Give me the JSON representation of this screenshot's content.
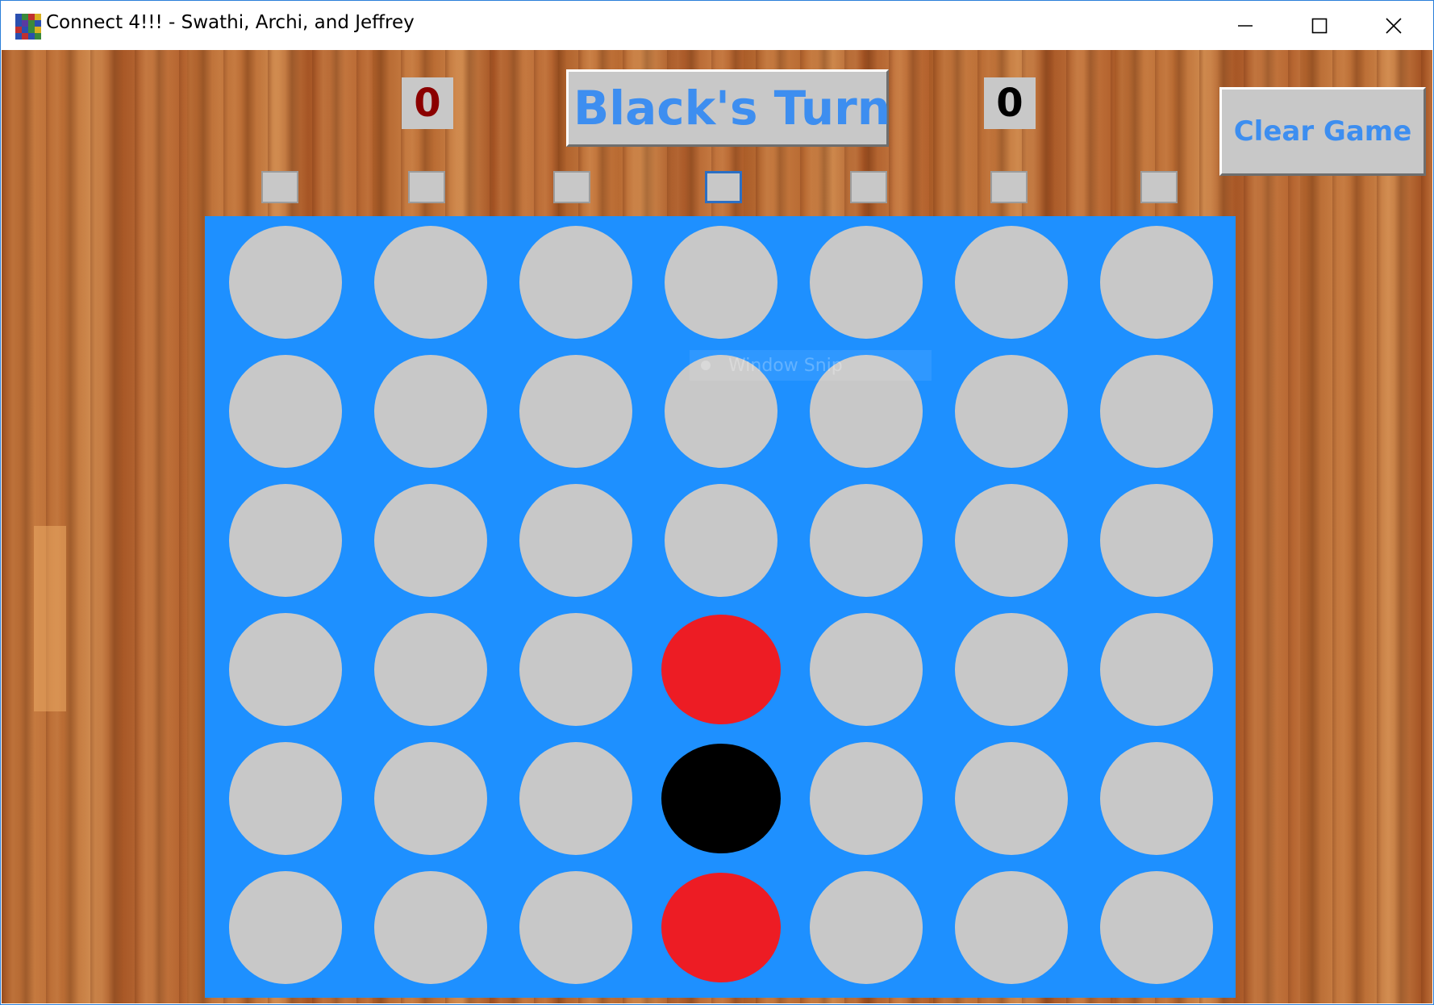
{
  "window": {
    "title": "Connect 4!!! - Swathi, Archi, and Jeffrey",
    "controls": [
      "minimize-icon",
      "maximize-icon",
      "close-icon"
    ]
  },
  "scores": {
    "red": "0",
    "black": "0",
    "red_color": "#8b0000",
    "black_color": "#000000"
  },
  "turn": {
    "text": "Black's Turn",
    "color": "#3d8ef0"
  },
  "clear_button": {
    "label": "Clear Game",
    "color": "#3d8ef0"
  },
  "colors": {
    "board": "#1e90ff",
    "empty": "#c8c8c8",
    "red": "#ed1c24",
    "black": "#000000"
  },
  "columns": 7,
  "rows": 6,
  "focused_column": 3,
  "board": [
    [
      "empty",
      "empty",
      "empty",
      "empty",
      "empty",
      "empty",
      "empty"
    ],
    [
      "empty",
      "empty",
      "empty",
      "empty",
      "empty",
      "empty",
      "empty"
    ],
    [
      "empty",
      "empty",
      "empty",
      "empty",
      "empty",
      "empty",
      "empty"
    ],
    [
      "empty",
      "empty",
      "empty",
      "red",
      "empty",
      "empty",
      "empty"
    ],
    [
      "empty",
      "empty",
      "empty",
      "black",
      "empty",
      "empty",
      "empty"
    ],
    [
      "empty",
      "empty",
      "empty",
      "red",
      "empty",
      "empty",
      "empty"
    ]
  ],
  "overlay": {
    "text": "Window Snip"
  }
}
